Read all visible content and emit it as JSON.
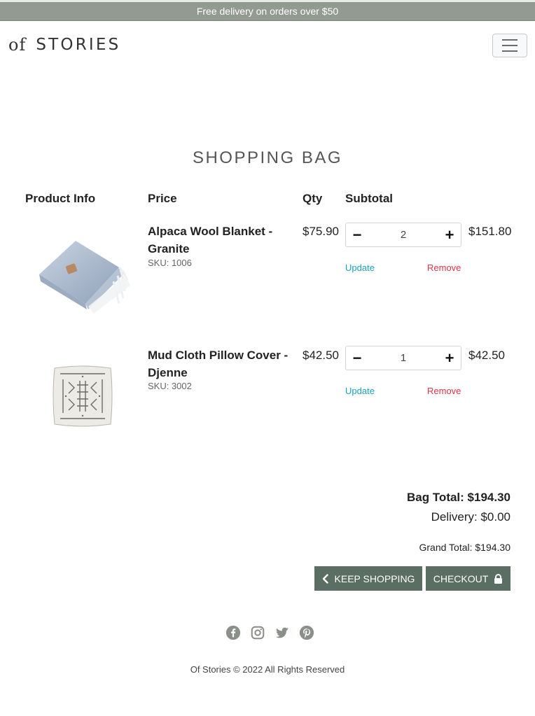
{
  "promo": {
    "text": "Free delivery on orders over $50"
  },
  "header": {
    "logo_of": "of",
    "logo_text": "STORIES"
  },
  "page": {
    "title": "SHOPPING BAG"
  },
  "table": {
    "headers": {
      "product": "Product Info",
      "price": "Price",
      "qty": "Qty",
      "subtotal": "Subtotal"
    },
    "rows": [
      {
        "name": "Alpaca Wool Blanket - Granite",
        "sku": "SKU: 1006",
        "price": "$75.90",
        "qty": "2",
        "subtotal": "$151.80",
        "update": "Update",
        "remove": "Remove"
      },
      {
        "name": "Mud Cloth Pillow Cover - Djenne",
        "sku": "SKU: 3002",
        "price": "$42.50",
        "qty": "1",
        "subtotal": "$42.50",
        "update": "Update",
        "remove": "Remove"
      }
    ]
  },
  "totals": {
    "bag_total": "Bag Total: $194.30",
    "delivery": "Delivery: $0.00",
    "grand_total": "Grand Total: $194.30"
  },
  "buttons": {
    "keep_shopping": "KEEP SHOPPING",
    "checkout": "CHECKOUT"
  },
  "social": [
    "facebook-icon",
    "instagram-icon",
    "twitter-icon",
    "pinterest-icon"
  ],
  "footer": {
    "text": "Of Stories © 2022 All Rights Reserved"
  },
  "colors": {
    "promo_bg": "#939a92",
    "button_bg": "#5b6e63",
    "update": "#17a2b8",
    "remove": "#dc3545",
    "social": "#8a8f8a"
  }
}
